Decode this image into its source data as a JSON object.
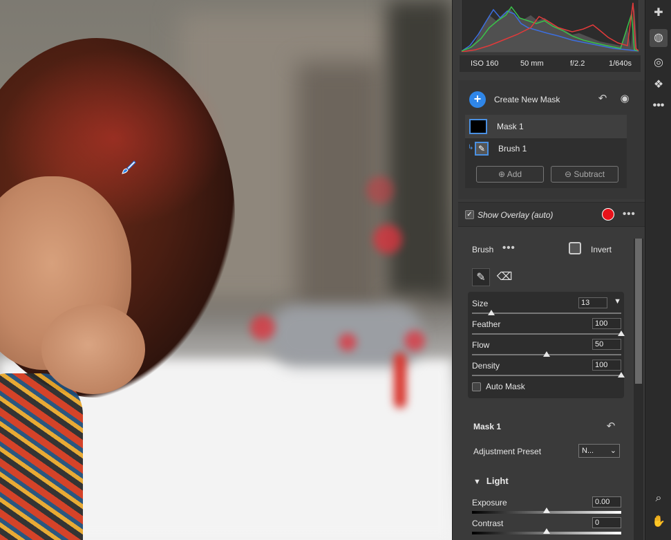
{
  "exif": {
    "iso": "ISO 160",
    "focal": "50 mm",
    "aperture": "f/2.2",
    "shutter": "1/640s"
  },
  "masks": {
    "create_label": "Create New Mask",
    "mask_name": "Mask 1",
    "component_name": "Brush 1",
    "add_label": "Add",
    "subtract_label": "Subtract"
  },
  "overlay": {
    "label": "Show Overlay (auto)",
    "checked": true,
    "color": "#e8121a"
  },
  "brush": {
    "title": "Brush",
    "invert_label": "Invert",
    "sliders": [
      {
        "label": "Size",
        "value": "13",
        "fraction": 0.13
      },
      {
        "label": "Feather",
        "value": "100",
        "fraction": 1.0
      },
      {
        "label": "Flow",
        "value": "50",
        "fraction": 0.5
      },
      {
        "label": "Density",
        "value": "100",
        "fraction": 1.0
      }
    ],
    "auto_mask_label": "Auto Mask"
  },
  "mask1": {
    "title": "Mask 1",
    "preset_label": "Adjustment Preset",
    "preset_value": "N..."
  },
  "light": {
    "title": "Light",
    "sliders": [
      {
        "label": "Exposure",
        "value": "0.00",
        "fraction": 0.5
      },
      {
        "label": "Contrast",
        "value": "0",
        "fraction": 0.5
      }
    ]
  },
  "colors": {
    "accent": "#2f86e8",
    "panel": "#3a3a3a",
    "toolbar": "#2b2b2b"
  }
}
